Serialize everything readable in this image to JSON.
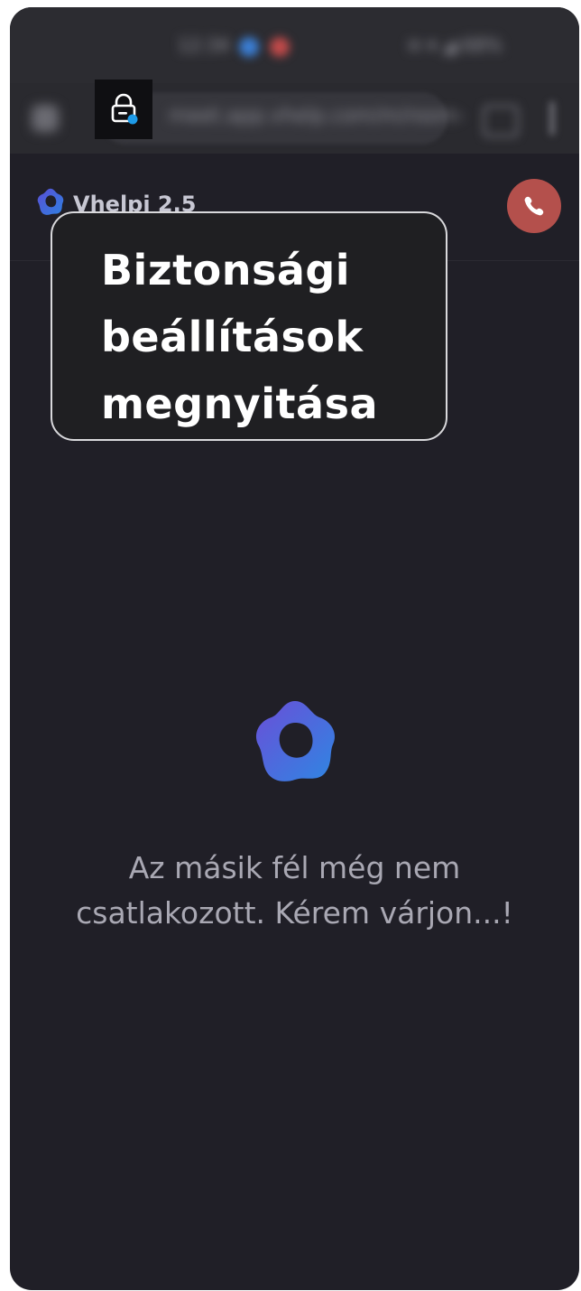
{
  "status_bar": {
    "time": "12:34",
    "right_indicators": "≋ ▾ ◢ 68%"
  },
  "browser": {
    "url": "meet.app.vhelp.com/m/room-"
  },
  "header": {
    "app_name": "Vhelpi 2.5"
  },
  "tooltip": {
    "text": "Biztonsági\nbeállítások\nmegnyitása"
  },
  "main": {
    "waiting_message": "Az másik fél még nem\ncsatlakozott. Kérem várjon...!"
  },
  "icons": {
    "lock": "lock-icon",
    "hangup": "phone-hangup-icon",
    "logo": "app-logo-icon"
  },
  "colors": {
    "background": "#201f27",
    "hangup": "#b4504c",
    "logo_gradient_start": "#5a4fd6",
    "logo_gradient_end": "#2f7fe0",
    "lock_badge": "#1e9be8"
  }
}
